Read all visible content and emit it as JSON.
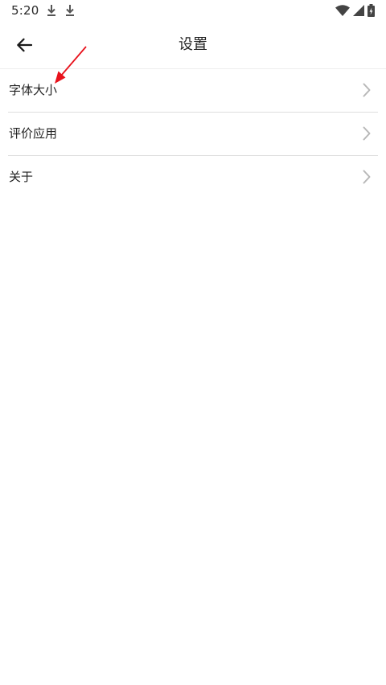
{
  "status_bar": {
    "time": "5:20",
    "icons": [
      "download-icon",
      "download-icon",
      "wifi-icon",
      "signal-icon",
      "battery-charging-icon"
    ]
  },
  "header": {
    "back_icon": "arrow-left-icon",
    "title": "设置"
  },
  "settings": {
    "items": [
      {
        "label": "字体大小",
        "icon": "chevron-right-icon"
      },
      {
        "label": "评价应用",
        "icon": "chevron-right-icon"
      },
      {
        "label": "关于",
        "icon": "chevron-right-icon"
      }
    ]
  },
  "colors": {
    "background": "#ffffff",
    "text": "#222222",
    "chevron": "#b8b8b8",
    "divider": "#dedede",
    "annotation_arrow": "#e8121c"
  }
}
